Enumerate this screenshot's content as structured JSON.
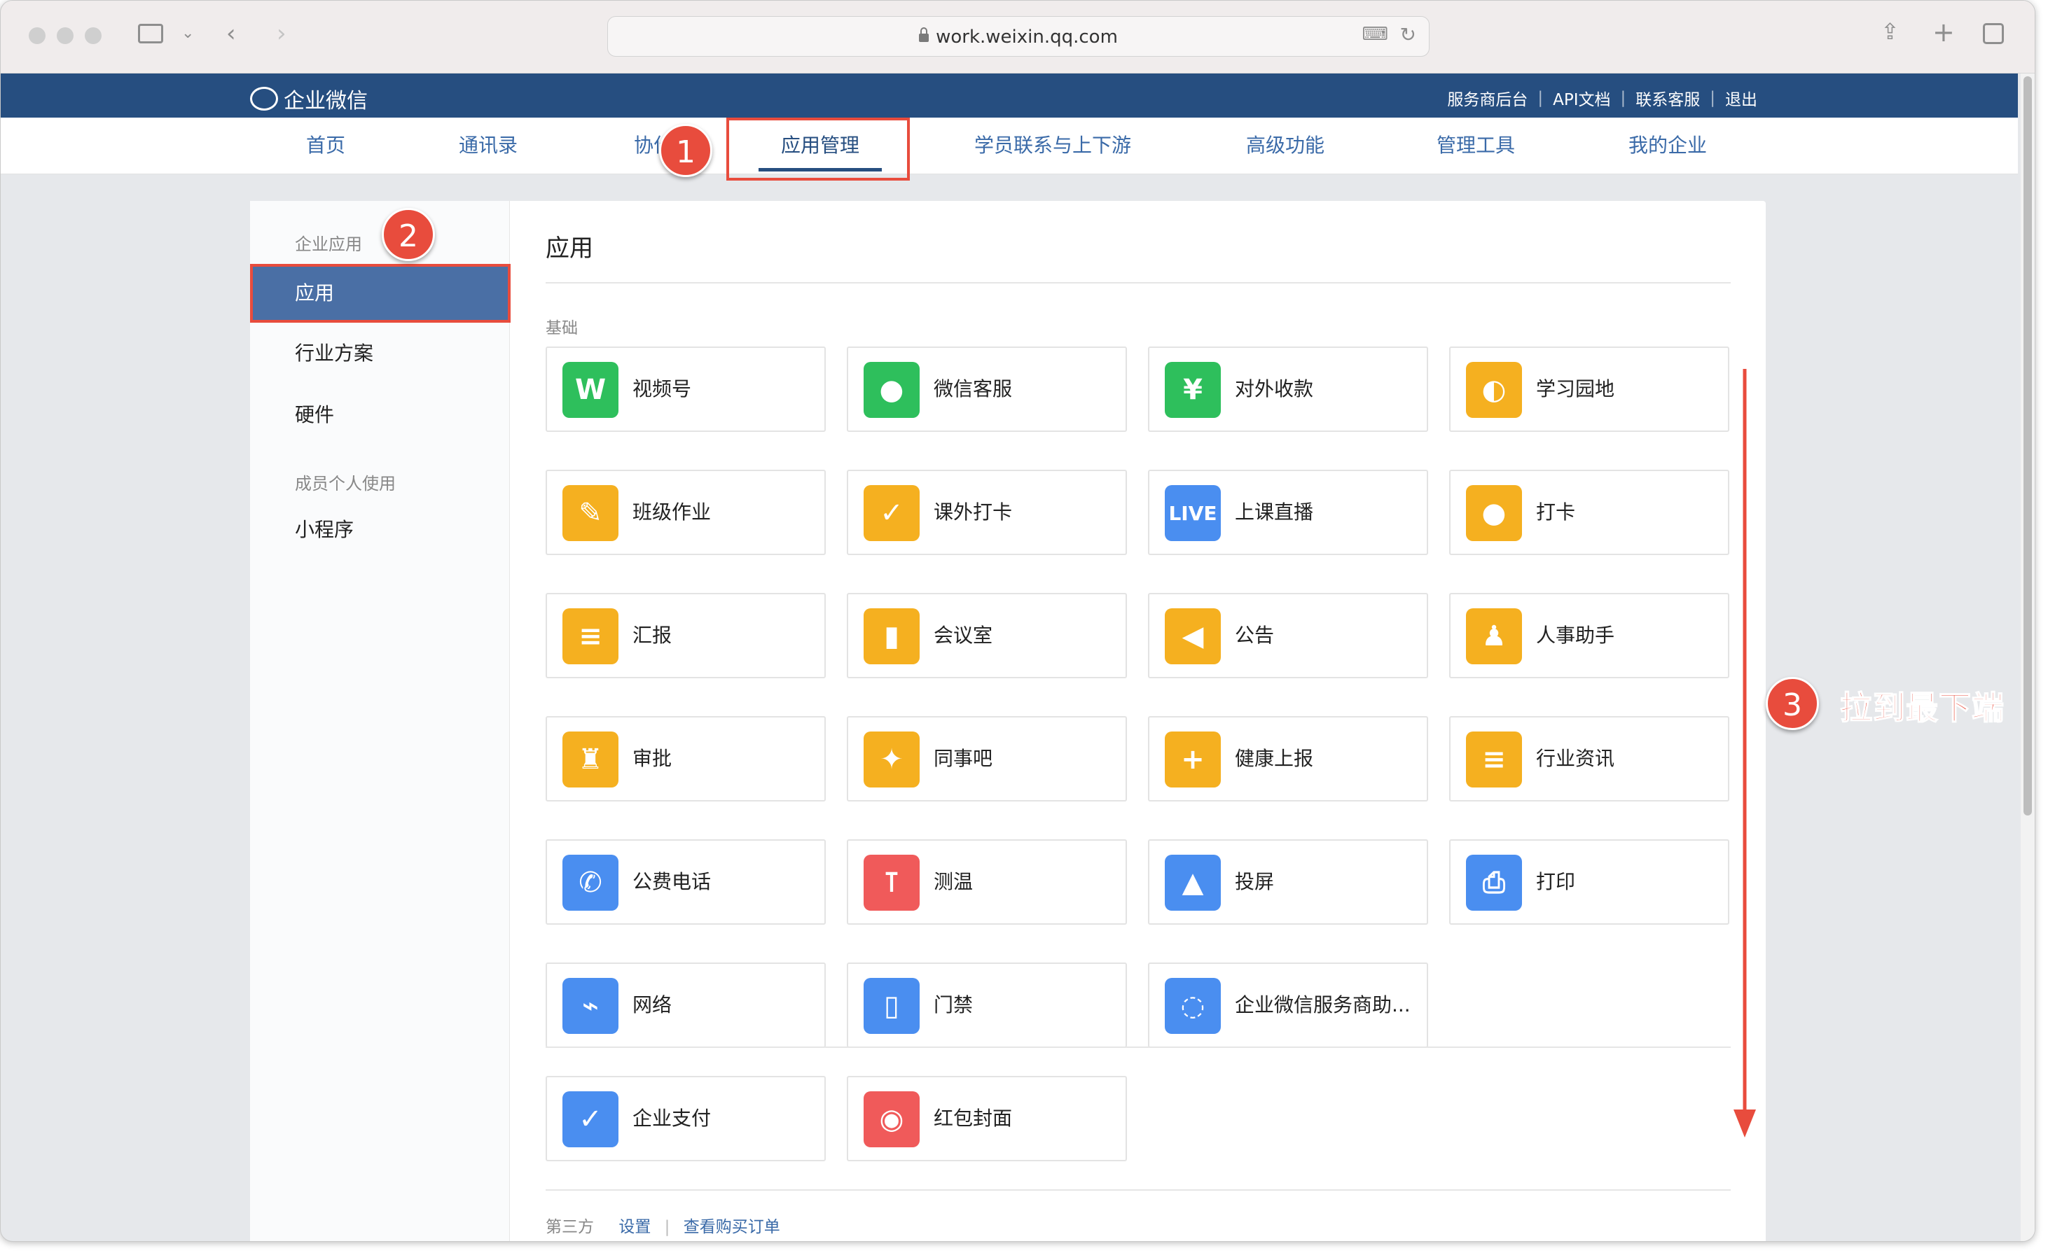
{
  "browser": {
    "url": "work.weixin.qq.com"
  },
  "header": {
    "logo_text": "企业微信",
    "links": [
      "服务商后台",
      "API文档",
      "联系客服",
      "退出"
    ]
  },
  "nav": {
    "items": [
      "首页",
      "通讯录",
      "协作",
      "应用管理",
      "学员联系与上下游",
      "高级功能",
      "管理工具",
      "我的企业"
    ],
    "active": "应用管理"
  },
  "sidebar": {
    "section1": "企业应用",
    "items": [
      "应用",
      "行业方案",
      "硬件"
    ],
    "active": "应用",
    "section2": "成员个人使用",
    "items2": [
      "小程序"
    ]
  },
  "main": {
    "title": "应用",
    "basics_label": "基础",
    "apps": [
      {
        "label": "视频号",
        "icon": "channels-icon",
        "color": "#2ebf5c"
      },
      {
        "label": "微信客服",
        "icon": "wechat-service-icon",
        "color": "#2ebf5c"
      },
      {
        "label": "对外收款",
        "icon": "payment-shield-icon",
        "color": "#2ebf5c"
      },
      {
        "label": "学习园地",
        "icon": "planet-icon",
        "color": "#f5b020"
      },
      {
        "label": "班级作业",
        "icon": "homework-icon",
        "color": "#f5b020"
      },
      {
        "label": "课外打卡",
        "icon": "calendar-check-icon",
        "color": "#f5b020"
      },
      {
        "label": "上课直播",
        "icon": "live-icon",
        "color": "#4a8ef0"
      },
      {
        "label": "打卡",
        "icon": "location-pin-icon",
        "color": "#f5b020"
      },
      {
        "label": "汇报",
        "icon": "report-icon",
        "color": "#f5b020"
      },
      {
        "label": "会议室",
        "icon": "door-icon",
        "color": "#f5b020"
      },
      {
        "label": "公告",
        "icon": "megaphone-icon",
        "color": "#f5b020"
      },
      {
        "label": "人事助手",
        "icon": "person-icon",
        "color": "#f5b020"
      },
      {
        "label": "审批",
        "icon": "stamp-icon",
        "color": "#f5b020"
      },
      {
        "label": "同事吧",
        "icon": "network-icon",
        "color": "#f5b020"
      },
      {
        "label": "健康上报",
        "icon": "clipboard-plus-icon",
        "color": "#f5b020"
      },
      {
        "label": "行业资讯",
        "icon": "news-icon",
        "color": "#f5b020"
      },
      {
        "label": "公费电话",
        "icon": "phone-icon",
        "color": "#4a8ef0"
      },
      {
        "label": "测温",
        "icon": "thermometer-icon",
        "color": "#f05a5a"
      },
      {
        "label": "投屏",
        "icon": "screencast-icon",
        "color": "#4a8ef0"
      },
      {
        "label": "打印",
        "icon": "printer-icon",
        "color": "#4a8ef0"
      },
      {
        "label": "网络",
        "icon": "router-icon",
        "color": "#4a8ef0"
      },
      {
        "label": "门禁",
        "icon": "access-door-icon",
        "color": "#4a8ef0"
      },
      {
        "label": "企业微信服务商助...",
        "icon": "chat-bubble-icon",
        "color": "#4a8ef0"
      }
    ],
    "extra_apps": [
      {
        "label": "企业支付",
        "icon": "enterprise-pay-icon",
        "color": "#4a8ef0"
      },
      {
        "label": "红包封面",
        "icon": "red-packet-icon",
        "color": "#f05a5a"
      }
    ],
    "third_party_label": "第三方",
    "third_party_links": [
      "设置",
      "查看购买订单"
    ]
  },
  "annotations": {
    "badge1": "1",
    "badge2": "2",
    "badge3": "3",
    "note3": "拉到最下端"
  }
}
